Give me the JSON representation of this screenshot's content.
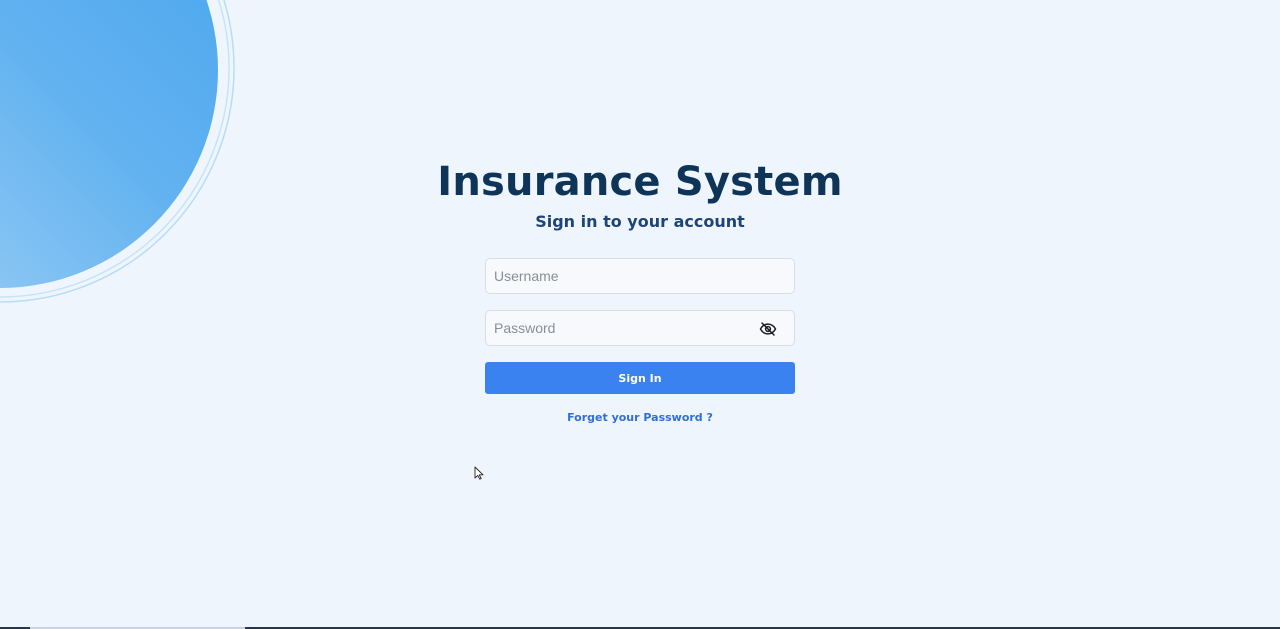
{
  "app": {
    "title": "Insurance System",
    "subtitle": "Sign in to your account"
  },
  "login_form": {
    "username": {
      "placeholder": "Username",
      "value": ""
    },
    "password": {
      "placeholder": "Password",
      "value": "",
      "toggle_icon": "eye-slash-icon"
    },
    "submit_label": "Sign In",
    "forgot_link": "Forget your Password ?"
  },
  "colors": {
    "background": "#eff5fd",
    "title": "#0e3558",
    "subtitle": "#1f4477",
    "primary_button": "#3b82f1",
    "link": "#2f6fd6",
    "decor_circle_light": "#9fcff5",
    "decor_circle_dark": "#4aa8ef"
  }
}
